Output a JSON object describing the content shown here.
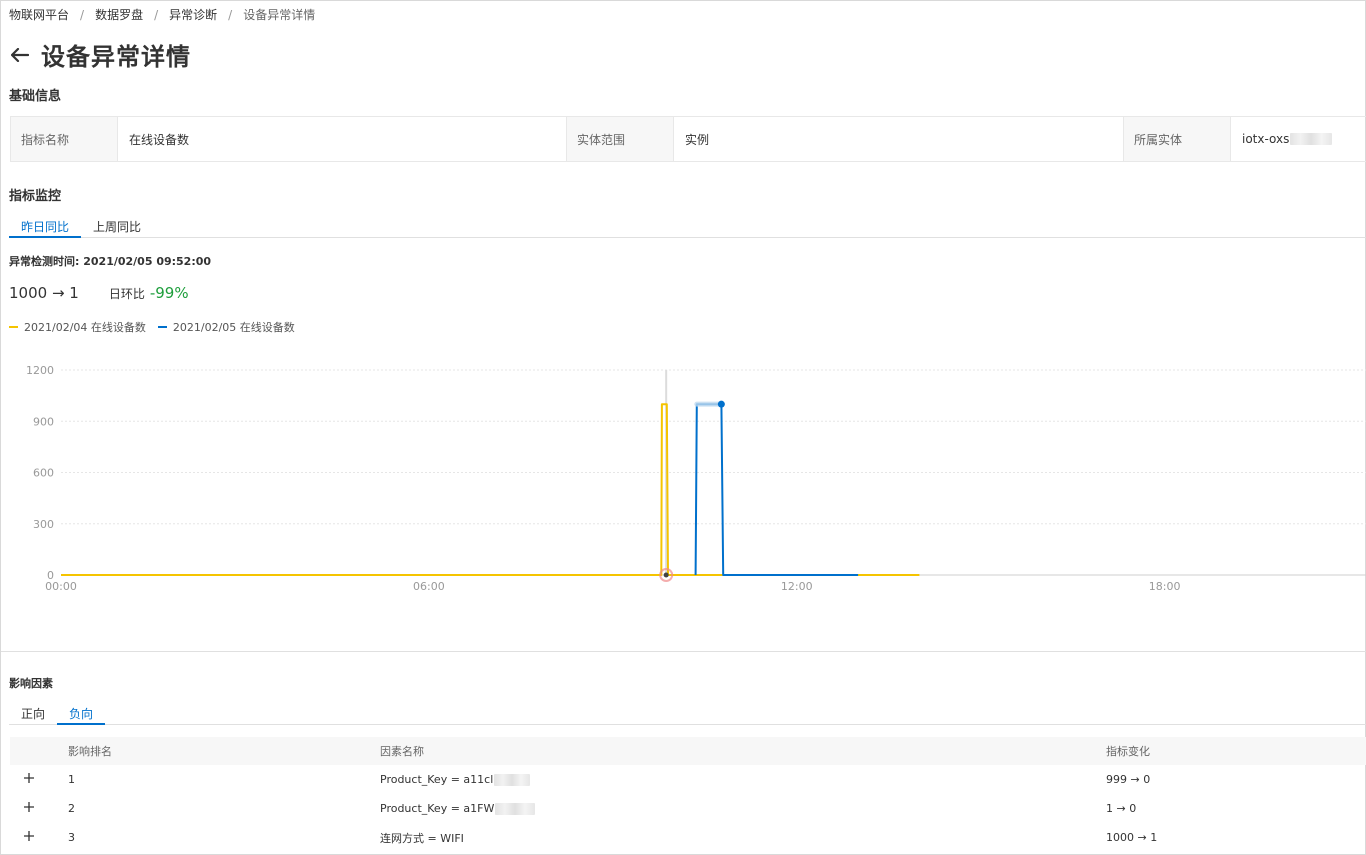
{
  "breadcrumb": {
    "items": [
      "物联网平台",
      "数据罗盘",
      "异常诊断"
    ],
    "current": "设备异常详情",
    "separator": "/"
  },
  "page": {
    "title": "设备异常详情",
    "back_icon": "arrow-left-icon"
  },
  "basic_info": {
    "title": "基础信息",
    "fields": [
      {
        "label": "指标名称",
        "value": "在线设备数"
      },
      {
        "label": "实体范围",
        "value": "实例"
      },
      {
        "label": "所属实体",
        "value": "iotx-oxs"
      }
    ]
  },
  "monitor": {
    "title": "指标监控",
    "tabs": [
      {
        "label": "昨日同比",
        "active": true
      },
      {
        "label": "上周同比",
        "active": false
      }
    ],
    "detect_time": "异常检测时间: 2021/02/05 09:52:00",
    "metric_change": "1000 → 1",
    "ratio_label": "日环比",
    "ratio_value": "-99%",
    "legend": [
      {
        "label": "2021/02/04 在线设备数",
        "color": "#f5c400"
      },
      {
        "label": "2021/02/05 在线设备数",
        "color": "#0070cc"
      }
    ]
  },
  "chart_data": {
    "type": "line",
    "x_ticks": [
      "00:00",
      "06:00",
      "12:00",
      "18:00"
    ],
    "y_ticks": [
      "0",
      "300",
      "600",
      "900",
      "1200"
    ],
    "ylim": [
      0,
      1200
    ],
    "xlim_hours": [
      0,
      21.3
    ],
    "grid": true,
    "legend": "top-left",
    "series": [
      {
        "name": "2021/02/04 在线设备数",
        "color": "#f5c400",
        "points": [
          [
            0,
            0
          ],
          [
            9.79,
            0
          ],
          [
            9.8,
            1000
          ],
          [
            9.88,
            1000
          ],
          [
            9.9,
            0
          ],
          [
            14,
            0
          ]
        ]
      },
      {
        "name": "2021/02/05 在线设备数",
        "color": "#0070cc",
        "points": [
          [
            10.35,
            0
          ],
          [
            10.37,
            1000
          ],
          [
            10.77,
            1000
          ],
          [
            10.8,
            0
          ],
          [
            13,
            0
          ]
        ]
      }
    ],
    "anomaly_x_hours": 9.87,
    "anomaly_marker_color": "#f08a8a"
  },
  "factors": {
    "title": "影响因素",
    "tabs": [
      {
        "label": "正向",
        "active": false
      },
      {
        "label": "负向",
        "active": true
      }
    ],
    "columns": [
      "影响排名",
      "因素名称",
      "指标变化"
    ],
    "rows": [
      {
        "rank": "1",
        "name": "Product_Key = a11cl",
        "change": "999 → 0",
        "blur": true
      },
      {
        "rank": "2",
        "name": "Product_Key = a1FW",
        "change": "1 → 0",
        "blur": true
      },
      {
        "rank": "3",
        "name": "连网方式 = WIFI",
        "change": "1000 → 1",
        "blur": false
      }
    ]
  }
}
